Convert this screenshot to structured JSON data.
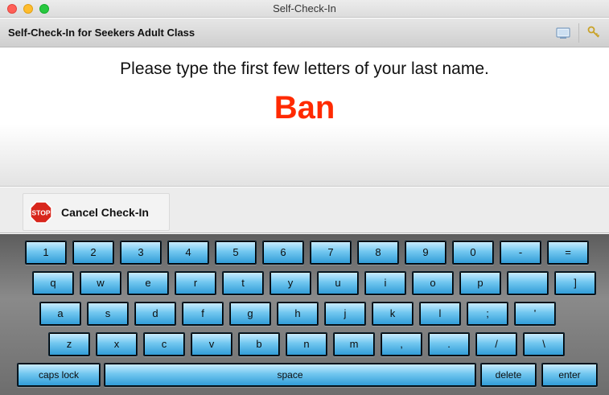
{
  "window": {
    "title": "Self-Check-In"
  },
  "toolbar": {
    "title": "Self-Check-In for Seekers Adult Class",
    "icons": [
      "display-icon",
      "keys-icon"
    ]
  },
  "prompt": {
    "instruction": "Please type the first few letters of your last name.",
    "typed_value": "Ban",
    "typed_color": "#ff2a00"
  },
  "actions": {
    "cancel_label": "Cancel Check-In",
    "stop_sign_text": "STOP",
    "stop_sign_color": "#d8261c"
  },
  "keyboard": {
    "key_color": "#4db3e6",
    "row1": [
      "1",
      "2",
      "3",
      "4",
      "5",
      "6",
      "7",
      "8",
      "9",
      "0",
      "-",
      "="
    ],
    "row2": [
      "q",
      "w",
      "e",
      "r",
      "t",
      "y",
      "u",
      "i",
      "o",
      "p",
      "",
      "]"
    ],
    "row3": [
      "a",
      "s",
      "d",
      "f",
      "g",
      "h",
      "j",
      "k",
      "l",
      ";",
      "'"
    ],
    "row4": [
      "z",
      "x",
      "c",
      "v",
      "b",
      "n",
      "m",
      ",",
      ".",
      "/",
      "\\"
    ],
    "row5": [
      "caps lock",
      "space",
      "delete",
      "enter"
    ]
  }
}
